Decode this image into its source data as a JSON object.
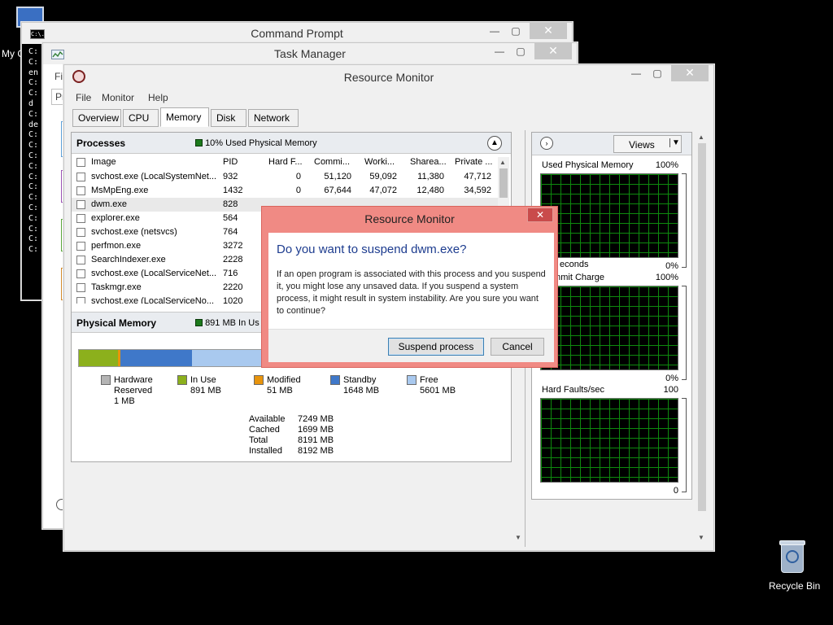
{
  "desktop": {
    "icons": {
      "my_computer": "My C",
      "recycle_bin": "Recycle Bin"
    }
  },
  "command_prompt": {
    "title": "Command Prompt",
    "icon_text": "C:\\.",
    "console_chars": [
      "C:",
      "C:",
      "en",
      "C:",
      "C:",
      "d",
      "C:",
      "de",
      "C:",
      "C:",
      "C:",
      "C:",
      "C:",
      "C:",
      "C:",
      "C:",
      "C:",
      "C:",
      "C:",
      "C:"
    ]
  },
  "task_manager": {
    "title": "Task Manager",
    "menu_file": "Fil",
    "tab_first": "Pr"
  },
  "resource_monitor": {
    "title": "Resource Monitor",
    "menu": [
      "File",
      "Monitor",
      "Help"
    ],
    "tabs": [
      "Overview",
      "CPU",
      "Memory",
      "Disk",
      "Network"
    ],
    "active_tab": "Memory",
    "processes": {
      "title": "Processes",
      "status": "10% Used Physical Memory",
      "columns": [
        "Image",
        "PID",
        "Hard F...",
        "Commi...",
        "Worki...",
        "Sharea...",
        "Private ..."
      ],
      "rows": [
        {
          "image": "svchost.exe (LocalSystemNet...",
          "pid": "932",
          "hard": "0",
          "commit": "51,120",
          "working": "59,092",
          "shareable": "11,380",
          "private": "47,712"
        },
        {
          "image": "MsMpEng.exe",
          "pid": "1432",
          "hard": "0",
          "commit": "67,644",
          "working": "47,072",
          "shareable": "12,480",
          "private": "34,592"
        },
        {
          "image": "dwm.exe",
          "pid": "828",
          "hard": "",
          "commit": "",
          "working": "",
          "shareable": "",
          "private": ""
        },
        {
          "image": "explorer.exe",
          "pid": "564",
          "hard": "",
          "commit": "",
          "working": "",
          "shareable": "",
          "private": ""
        },
        {
          "image": "svchost.exe (netsvcs)",
          "pid": "764",
          "hard": "",
          "commit": "",
          "working": "",
          "shareable": "",
          "private": ""
        },
        {
          "image": "perfmon.exe",
          "pid": "3272",
          "hard": "",
          "commit": "",
          "working": "",
          "shareable": "",
          "private": ""
        },
        {
          "image": "SearchIndexer.exe",
          "pid": "2228",
          "hard": "",
          "commit": "",
          "working": "",
          "shareable": "",
          "private": ""
        },
        {
          "image": "svchost.exe (LocalServiceNet...",
          "pid": "716",
          "hard": "",
          "commit": "",
          "working": "",
          "shareable": "",
          "private": ""
        },
        {
          "image": "Taskmgr.exe",
          "pid": "2220",
          "hard": "",
          "commit": "",
          "working": "",
          "shareable": "",
          "private": ""
        },
        {
          "image": "svchost.exe (LocalServiceNo...",
          "pid": "1020",
          "hard": "",
          "commit": "",
          "working": "",
          "shareable": "",
          "private": ""
        }
      ]
    },
    "physical_memory": {
      "title": "Physical Memory",
      "status": "891 MB In Us",
      "bar_mb": {
        "hardware_reserved": 1,
        "in_use": 891,
        "modified": 51,
        "standby": 1648,
        "free": 5601
      },
      "legend": [
        {
          "label": "Hardware Reserved",
          "label_line1": "Hardware",
          "label_line2": "Reserved",
          "value": "1 MB",
          "color": "#b4b4b4"
        },
        {
          "label": "In Use",
          "label_line1": "In Use",
          "label_line2": "",
          "value": "891 MB",
          "color": "#8cb01c"
        },
        {
          "label": "Modified",
          "label_line1": "Modified",
          "label_line2": "",
          "value": "51 MB",
          "color": "#e8940c"
        },
        {
          "label": "Standby",
          "label_line1": "Standby",
          "label_line2": "",
          "value": "1648 MB",
          "color": "#3f78c9"
        },
        {
          "label": "Free",
          "label_line1": "Free",
          "label_line2": "",
          "value": "5601 MB",
          "color": "#a9c9ef"
        }
      ],
      "summary": [
        {
          "label": "Available",
          "value": "7249 MB"
        },
        {
          "label": "Cached",
          "value": "1699 MB"
        },
        {
          "label": "Total",
          "value": "8191 MB"
        },
        {
          "label": "Installed",
          "value": "8192 MB"
        }
      ]
    },
    "views_button": "Views",
    "graphs": [
      {
        "title": "Used Physical Memory",
        "max": "100%",
        "min": "0%"
      },
      {
        "title": "Commit Charge",
        "max": "100%",
        "min": "0%",
        "overlay_left": "mmit Charge"
      },
      {
        "title": "Hard Faults/sec",
        "max": "100",
        "min": "0"
      }
    ],
    "graph_partial_label": "econds"
  },
  "dialog": {
    "title": "Resource Monitor",
    "heading": "Do you want to suspend dwm.exe?",
    "body": "If an open program is associated with this process and you suspend it, you might lose any unsaved data. If you suspend a system process, it might result in system instability. Are you sure you want to continue?",
    "primary_button": "Suspend process",
    "cancel_button": "Cancel"
  }
}
